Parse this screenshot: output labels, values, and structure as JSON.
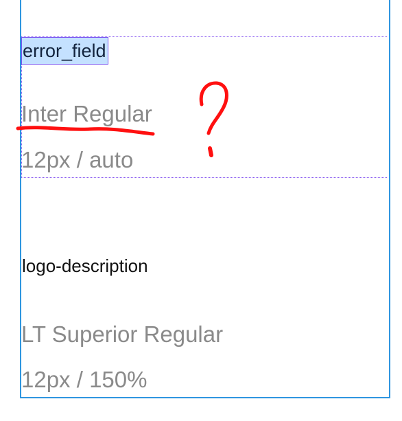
{
  "styles": [
    {
      "name": "error_field",
      "font": "Inter Regular",
      "size": "12px / auto"
    },
    {
      "name": "logo-description",
      "font": "LT Superior Regular",
      "size": "12px / 150%"
    }
  ],
  "annotation": {
    "mark": "?",
    "color": "#ff0000"
  },
  "colors": {
    "frame": "#2f96e0",
    "selection": "#8a5cf0",
    "selection_fill": "#c4e1ff",
    "muted_text": "#8a8a8a"
  }
}
